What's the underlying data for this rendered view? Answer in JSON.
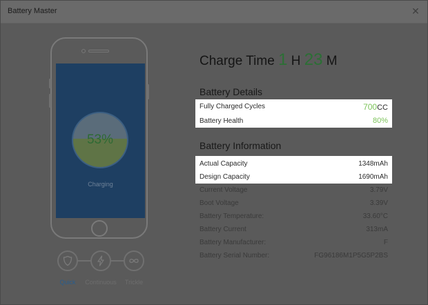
{
  "window": {
    "title": "Battery Master",
    "close_glyph": "✕"
  },
  "phone": {
    "percent": "53%",
    "percent_value": 53,
    "status": "Charging"
  },
  "modes": [
    {
      "label": "Quick",
      "icon": "shield-icon",
      "active": true
    },
    {
      "label": "Continuous",
      "icon": "lightning-icon",
      "active": false
    },
    {
      "label": "Trickle",
      "icon": "infinity-icon",
      "active": false
    }
  ],
  "charge_time": {
    "label": "Charge Time",
    "hours": "1",
    "h_unit": "H",
    "minutes": "23",
    "m_unit": "M"
  },
  "battery_details": {
    "title": "Battery Details",
    "rows": [
      {
        "label": "Fully Charged Cycles",
        "value": "700",
        "unit": "CC"
      },
      {
        "label": "Battery Health",
        "value": "80%"
      }
    ]
  },
  "battery_info": {
    "title": "Battery Information",
    "rows": [
      {
        "label": "Actual Capacity",
        "value": "1348mAh"
      },
      {
        "label": "Design Capacity",
        "value": "1690mAh"
      },
      {
        "label": "Current Voltage",
        "value": "3.79V"
      },
      {
        "label": "Boot Voltage",
        "value": "3.39V"
      },
      {
        "label": "Battery Temperature:",
        "value": "33.60°C"
      },
      {
        "label": "Battery Current",
        "value": "313mA"
      },
      {
        "label": "Battery Manufacturer:",
        "value": "F"
      },
      {
        "label": "Battery Serial Number:",
        "value": "FG96186M1P5G5P2BS"
      }
    ]
  },
  "colors": {
    "accent_green": "#7cc35a",
    "screen_blue": "#1e3f62",
    "active_mode": "#2a5d8c"
  }
}
